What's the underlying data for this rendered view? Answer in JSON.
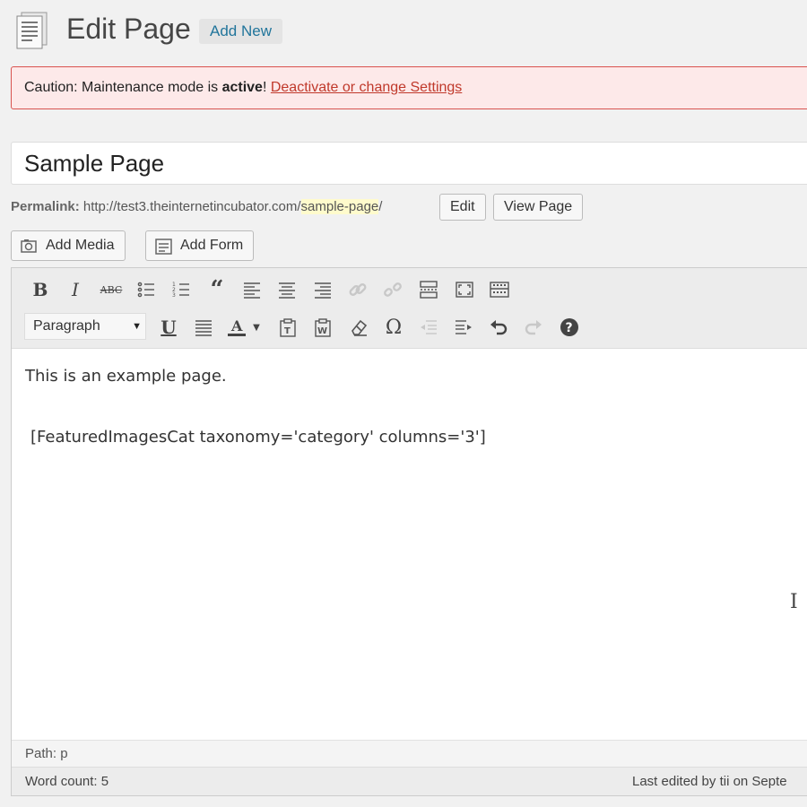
{
  "header": {
    "title": "Edit Page",
    "add_new": "Add New"
  },
  "notice": {
    "prefix": "Caution: Maintenance mode is ",
    "bold": "active",
    "suffix": "! ",
    "link": "Deactivate or change Settings"
  },
  "post": {
    "title": "Sample Page",
    "permalink_label": "Permalink:",
    "permalink_base": "http://test3.theinternetincubator.com/",
    "permalink_slug": "sample-page",
    "permalink_end": "/",
    "edit_label": "Edit",
    "view_label": "View Page"
  },
  "media": {
    "add_media": "Add Media",
    "add_form": "Add Form"
  },
  "toolbar": {
    "format_value": "Paragraph"
  },
  "content": {
    "line1": "This is an example page.",
    "line2": "[FeaturedImagesCat taxonomy='category' columns='3']"
  },
  "footer": {
    "path": "Path: p",
    "word_count": "Word count: 5",
    "last_edited": "Last edited by tii on Septe"
  },
  "colors": {
    "notice_bg": "#fde9e9",
    "notice_border": "#d9534f",
    "link": "#21759b",
    "slug_highlight": "#fffbcc"
  }
}
